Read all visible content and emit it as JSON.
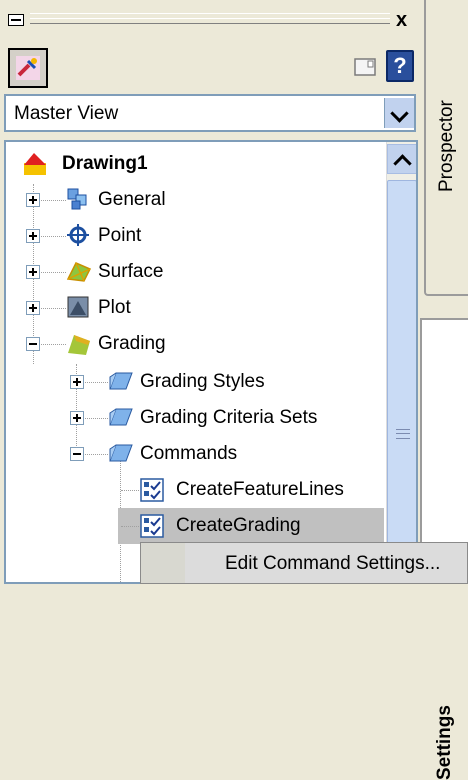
{
  "titlebar": {
    "close_label": "x"
  },
  "dropdown": {
    "value": "Master View"
  },
  "tree": {
    "root": {
      "label": "Drawing1"
    },
    "items": [
      {
        "label": "General"
      },
      {
        "label": "Point"
      },
      {
        "label": "Surface"
      },
      {
        "label": "Plot"
      },
      {
        "label": "Grading"
      },
      {
        "label": "Grading Styles"
      },
      {
        "label": "Grading Criteria Sets"
      },
      {
        "label": "Commands"
      },
      {
        "label": "CreateFeatureLines"
      },
      {
        "label": "CreateGrading"
      }
    ]
  },
  "tabs": {
    "prospector": "Prospector",
    "settings": "Settings"
  },
  "help": {
    "label": "?"
  },
  "context_menu": {
    "item": "Edit Command Settings..."
  }
}
